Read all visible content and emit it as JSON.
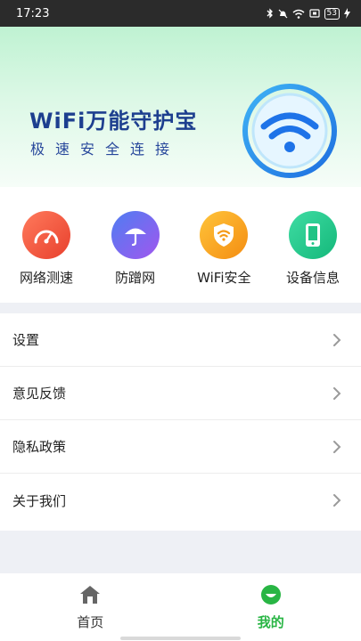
{
  "status_bar": {
    "time": "17:23",
    "battery": "53",
    "icons": [
      "bluetooth-icon",
      "mute-icon",
      "wifi-icon",
      "sim-icon",
      "battery-icon",
      "charging-icon"
    ]
  },
  "banner": {
    "title": "WiFi万能守护宝",
    "subtitle": "极速安全连接"
  },
  "tools": [
    {
      "label": "网络测速",
      "icon": "speedometer-icon",
      "color": "#f0543f"
    },
    {
      "label": "防蹭网",
      "icon": "umbrella-icon",
      "color": "#7b5cf0"
    },
    {
      "label": "WiFi安全",
      "icon": "wifi-shield-icon",
      "color": "#f7a21c"
    },
    {
      "label": "设备信息",
      "icon": "phone-icon",
      "color": "#27c98f"
    }
  ],
  "menu": [
    {
      "label": "设置"
    },
    {
      "label": "意见反馈"
    },
    {
      "label": "隐私政策"
    },
    {
      "label": "关于我们"
    }
  ],
  "tab_bar": {
    "home_label": "首页",
    "mine_label": "我的",
    "active_color": "#28b544",
    "inactive_color": "#333333"
  }
}
